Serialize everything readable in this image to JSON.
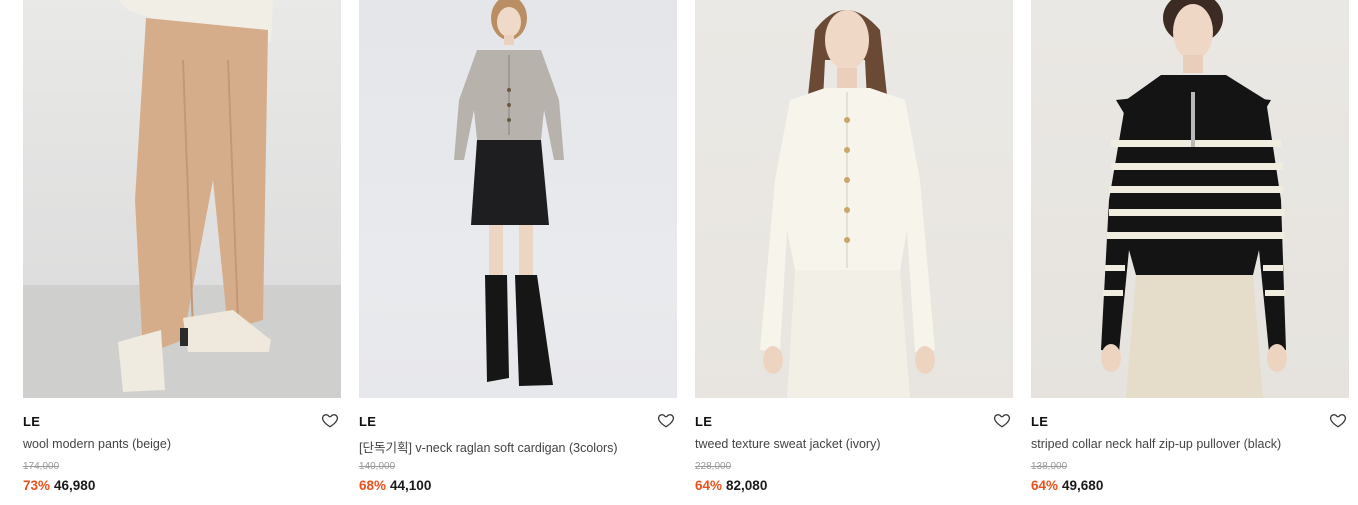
{
  "products": [
    {
      "brand": "LE",
      "title": "wool modern pants (beige)",
      "original_price": "174,000",
      "discount": "73%",
      "price": "46,980",
      "image_subject": "beige wool pants with ivory ankle boots"
    },
    {
      "brand": "LE",
      "title": "[단독기획] v-neck raglan soft cardigan (3colors)",
      "original_price": "140,000",
      "discount": "68%",
      "price": "44,100",
      "image_subject": "grey v-neck cardigan with black mini skirt and boots"
    },
    {
      "brand": "LE",
      "title": "tweed texture sweat jacket (ivory)",
      "original_price": "228,000",
      "discount": "64%",
      "price": "82,080",
      "image_subject": "ivory tweed jacket with white skirt"
    },
    {
      "brand": "LE",
      "title": "striped collar neck half zip-up pullover (black)",
      "original_price": "138,000",
      "discount": "64%",
      "price": "49,680",
      "image_subject": "black and ivory striped collar pullover"
    }
  ],
  "colors": {
    "discount": "#e8511c",
    "strike_price": "#9a9a9a",
    "text": "#222222"
  },
  "icons": {
    "wishlist": "heart-outline-icon"
  }
}
